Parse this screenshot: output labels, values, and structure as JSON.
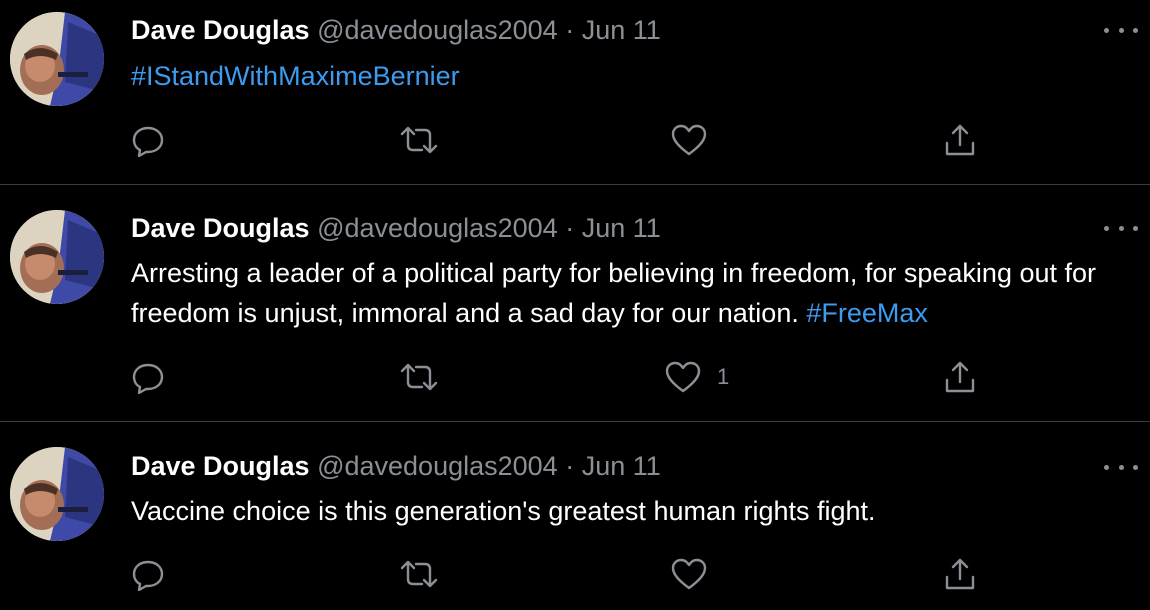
{
  "tweets": [
    {
      "author_name": "Dave Douglas",
      "handle": "@davedouglas2004",
      "separator": "·",
      "date": "Jun 11",
      "text_parts": [
        {
          "text": "#IStandWithMaximeBernier",
          "type": "hashtag"
        }
      ],
      "like_count": ""
    },
    {
      "author_name": "Dave Douglas",
      "handle": "@davedouglas2004",
      "separator": "·",
      "date": "Jun 11",
      "text_parts": [
        {
          "text": "Arresting a leader of a political party for believing in freedom, for speaking out for freedom is unjust, immoral and a sad day for our nation. ",
          "type": "text"
        },
        {
          "text": "#FreeMax",
          "type": "hashtag"
        }
      ],
      "like_count": "1"
    },
    {
      "author_name": "Dave Douglas",
      "handle": "@davedouglas2004",
      "separator": "·",
      "date": "Jun 11",
      "text_parts": [
        {
          "text": "Vaccine choice is this generation's greatest human rights fight.",
          "type": "text"
        }
      ],
      "like_count": ""
    }
  ],
  "icons": {
    "more": "more-icon",
    "reply": "reply-icon",
    "retweet": "retweet-icon",
    "like": "like-icon",
    "share": "share-icon"
  },
  "colors": {
    "background": "#000000",
    "name": "#ffffff",
    "secondary": "#8b9096",
    "hashtag": "#3d9bf0",
    "divider": "#3a3d40"
  }
}
